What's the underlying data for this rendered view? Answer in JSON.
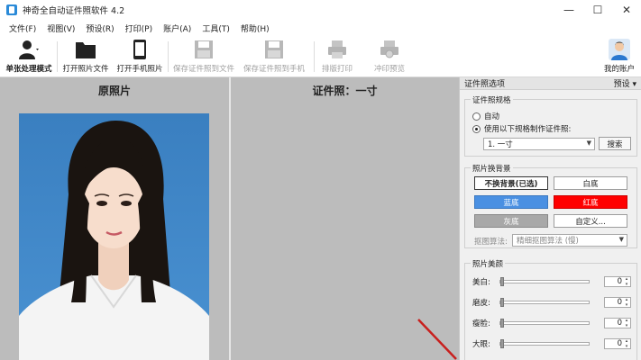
{
  "window": {
    "title": "神奇全自动证件照软件 4.2"
  },
  "menu": [
    "文件(F)",
    "视图(V)",
    "预设(R)",
    "打印(P)",
    "账户(A)",
    "工具(T)",
    "帮助(H)"
  ],
  "toolbar": {
    "single_mode": "单张处理模式",
    "open_photo": "打开照片文件",
    "open_phone": "打开手机照片",
    "save_file": "保存证件照到文件",
    "save_phone": "保存证件照到手机",
    "layout_print": "排版打印",
    "print_preview": "冲印预览",
    "my_account": "我的账户"
  },
  "panes": {
    "original_title": "原照片",
    "id_title": "证件照：一寸"
  },
  "panel": {
    "header": "证件照选项",
    "preset": "预设",
    "spec_title": "证件照规格",
    "auto": "自动",
    "use_spec": "使用以下规格制作证件照:",
    "spec_value": "1. 一寸",
    "search": "搜索",
    "bg_title": "照片换背景",
    "no_change": "不换背景(已选)",
    "white": "白底",
    "blue": "蓝底",
    "red": "红底",
    "gray": "灰底",
    "custom": "自定义...",
    "algo_label": "抠图算法:",
    "algo_value": "精细抠图算法 (慢)",
    "beauty_title": "照片美颜",
    "sliders": [
      {
        "label": "美白:",
        "value": "0"
      },
      {
        "label": "磨皮:",
        "value": "0"
      },
      {
        "label": "瘦脸:",
        "value": "0"
      },
      {
        "label": "大眼:",
        "value": "0"
      }
    ]
  },
  "colors": {
    "blue": "#4a90e2",
    "red": "#ff0000",
    "gray": "#a8a8a8",
    "photo_bg": "#3e86c6"
  }
}
